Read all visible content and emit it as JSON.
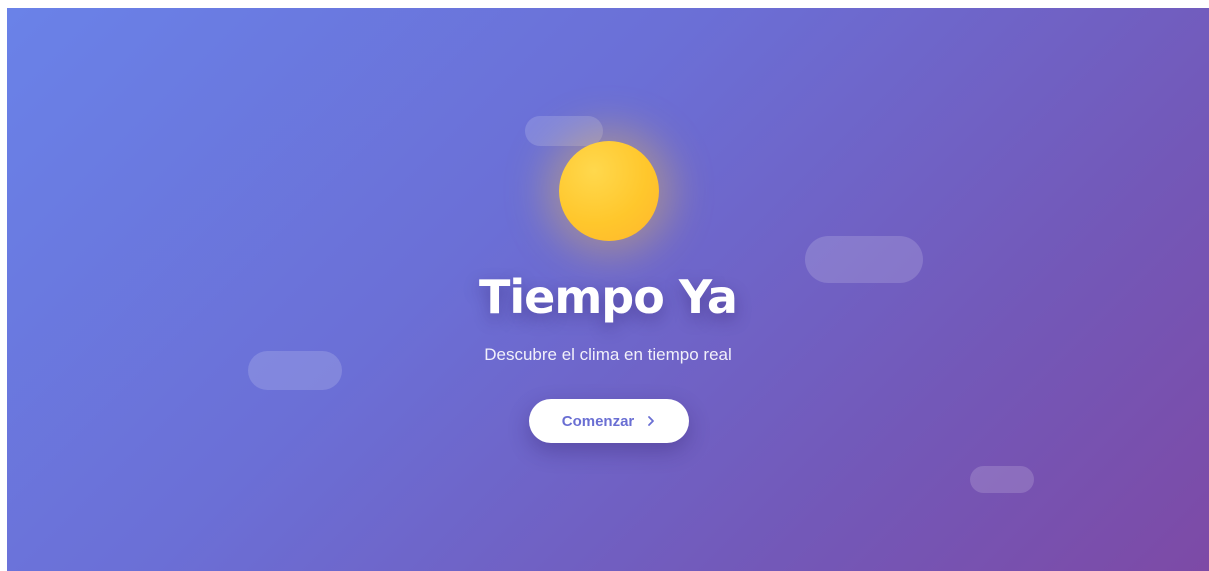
{
  "hero": {
    "title": "Tiempo Ya",
    "subtitle": "Descubre el clima en tiempo real",
    "cta_label": "Comenzar",
    "cta_icon": "chevron-right-icon",
    "sun_icon": "sun-icon"
  },
  "colors": {
    "gradient_start": "#6a82e8",
    "gradient_end": "#7d4aa6",
    "sun": "#ffc72c",
    "cta_text": "#6a6fd3",
    "cta_background": "#ffffff"
  }
}
